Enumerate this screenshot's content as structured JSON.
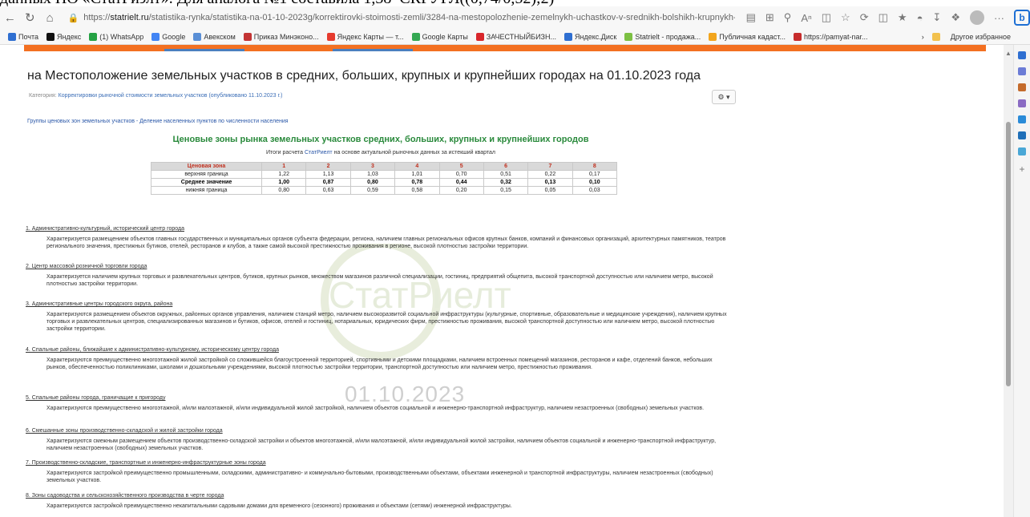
{
  "overflow_text": "данных НО «СтатРиэлт». Для аналога №1 составила 1,38*СКРУГЛ((0,74/0,52);2)",
  "browser": {
    "url_prefix": "https://",
    "url_host": "statrielt.ru",
    "url_path": "/statistika-rynka/statistika-na-01-10-2023g/korrektirovki-stoimosti-zemli/3284-na-mestopolozhenie-zemelnykh-uchastkov-v-srednikh-bolshikh-krupnykh-..."
  },
  "bookmarks": {
    "items": [
      {
        "label": "Почта",
        "color": "#2f6fd1"
      },
      {
        "label": "Яндекс",
        "color": "#111111"
      },
      {
        "label": "(1) WhatsApp",
        "color": "#25a244"
      },
      {
        "label": "Google",
        "color": "#4285f4"
      },
      {
        "label": "Авекском",
        "color": "#5a8fd6"
      },
      {
        "label": "Приказ Минэконо...",
        "color": "#c33434"
      },
      {
        "label": "Яндекс Карты — т...",
        "color": "#e63b2e"
      },
      {
        "label": "Google Карты",
        "color": "#34a853"
      },
      {
        "label": "ЗАЧЕСТНЫЙБИЗН...",
        "color": "#d8262b"
      },
      {
        "label": "Яндекс.Диск",
        "color": "#2f6fd1"
      },
      {
        "label": "Statrielt - продажа...",
        "color": "#7cc043"
      },
      {
        "label": "Публичная кадаст...",
        "color": "#f2a51d"
      },
      {
        "label": "https://pamyat-nar...",
        "color": "#c72c2c"
      }
    ],
    "other_label": "Другое избранное"
  },
  "page": {
    "title": "на Местоположение земельных участков в средних, больших, крупных и крупнейших городах на 01.10.2023 года",
    "category_label": "Категория:",
    "category_link": "Корректировки рыночной стоимости земельных участков",
    "published": "(опубликовано 11.10.2023 г.)",
    "groups_link": "Группы ценовых зон земельных участков - Деление населенных пунктов по численности населения",
    "zones_title": "Ценовые зоны рынка земельных участков средних, больших, крупных и крупнейших городов",
    "results_prefix": "Итоги расчета",
    "results_link": "СтатРиелт",
    "results_suffix": "на основе актуальной рыночных данных за истекший квартал",
    "watermark_text": "01.10.2023"
  },
  "table": {
    "header": [
      "Ценовая зона",
      "1",
      "2",
      "3",
      "4",
      "5",
      "6",
      "7",
      "8"
    ],
    "rows": [
      {
        "label": "верхняя граница",
        "values": [
          "1,22",
          "1,13",
          "1,03",
          "1,01",
          "0,70",
          "0,51",
          "0,22",
          "0,17"
        ]
      },
      {
        "label": "Среднее значение",
        "values": [
          "1,00",
          "0,87",
          "0,80",
          "0,78",
          "0,44",
          "0,32",
          "0,13",
          "0,10"
        ]
      },
      {
        "label": "нижняя граница",
        "values": [
          "0,80",
          "0,63",
          "0,59",
          "0,58",
          "0,20",
          "0,15",
          "0,05",
          "0,03"
        ]
      }
    ]
  },
  "sections": [
    {
      "title": "1. Административно-культурный, исторический центр города",
      "desc": "Характеризуется размещением объектов главных государственных и муниципальных органов субъекта федерации, региона, наличием главных региональных офисов крупных банков, компаний и финансовых организаций, архитектурных памятников, театров регионального значения, престижных бутиков, отелей, ресторанов и клубов, а также самой высокой престижностью проживания в регионе, высокой плотностью застройки территории."
    },
    {
      "title": "2. Центр массовой розничной торговли города",
      "desc": "Характеризуется наличием крупных торговых и развлекательных центров, бутиков, крупных рынков, множеством магазинов различной специализации, гостиниц, предприятий общепита, высокой транспортной доступностью или наличием метро, высокой плотностью застройки территории."
    },
    {
      "title": "3. Административные центры городского округа, района",
      "desc": "Характеризуются размещением объектов окружных, районных органов управления, наличием станций метро, наличием высокоразвитой социальной инфраструктуры (культурные, спортивные, образовательные и медицинские учреждения), наличием крупных торговых и развлекательных центров, специализированных магазинов и бутиков, офисов, отелей и гостиниц, нотариальных, юридических фирм, престижностью проживания, высокой транспортной доступностью или наличием метро, высокой плотностью застройки территории."
    },
    {
      "title": "4. Спальные районы, ближайшие к административно-культурному, историческому центру города",
      "desc": "Характеризуются преимущественно многоэтажной жилой застройкой со сложившейся благоустроенной территорией, спортивными и детскими площадками, наличием встроенных помещений магазинов, ресторанов и кафе, отделений банков, небольших рынков, обеспеченностью поликлиниками, школами и дошкольными учреждениями, высокой плотностью застройки территории, транспортной доступностью или наличием метро, престижностью проживания."
    },
    {
      "title": "5. Спальные районы города, граничащие к пригороду",
      "desc": "Характеризуются преимущественно многоэтажной, и/или малоэтажной, и/или индивидуальной жилой застройкой, наличием объектов социальной и инженерно-транспортной инфраструктур, наличием незастроенных (свободных) земельных участков."
    },
    {
      "title": "6. Смешанные зоны производственно-складской и жилой застройки города",
      "desc": "Характеризуются смежным размещением объектов производственно-складской застройки и объектов многоэтажной, и/или малоэтажной, и/или индивидуальной жилой застройки, наличием объектов социальной и инженерно-транспортной инфраструктур, наличием незастроенных (свободных) земельных участков."
    },
    {
      "title": "7. Производственно-складские, транспортные и инженерно-инфраструктурные зоны города",
      "desc": "Характеризуются застройкой преимущественно промышленными, складскими, административно- и коммунально-бытовыми, производственными объектами, объектами инженерной и транспортной инфраструктуры, наличием незастроенных (свободных) земельных участков."
    },
    {
      "title": "8. Зоны садоводства и сельскохозяйственного производства в черте города",
      "desc": "Характеризуются застройкой преимущественно некапитальными садовыми домами для временного (сезонного) проживания и объектами (сетями) инженерной инфраструктуры."
    }
  ]
}
